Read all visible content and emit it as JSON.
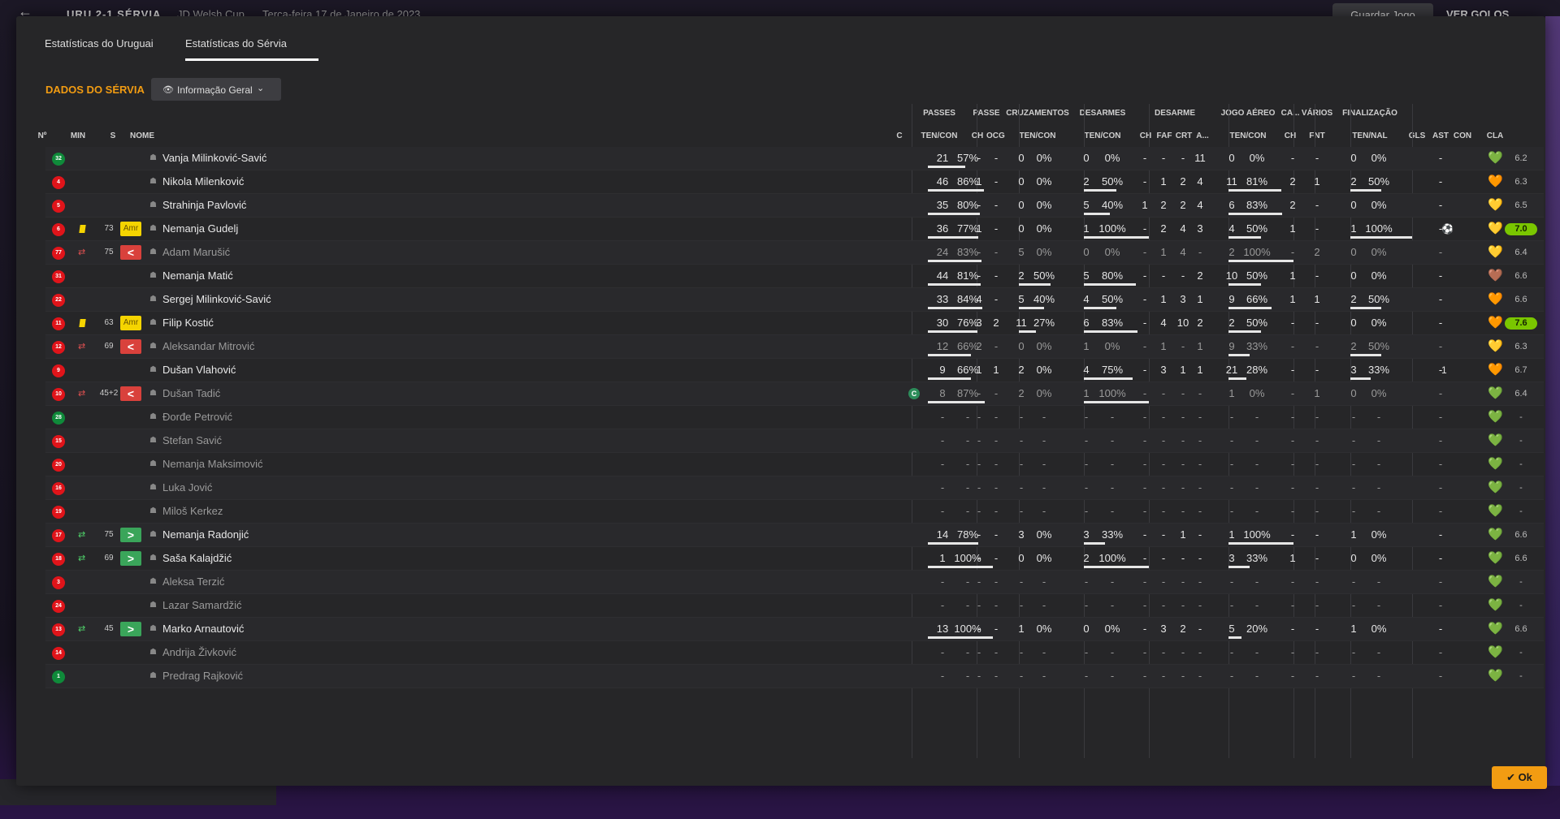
{
  "topbar": {
    "back": "←",
    "score": "URU 2-1 SÉRVIA",
    "competition": "JD Welsh Cup",
    "date": "Terça-feira 17 de Janeiro de 2023",
    "save": "Guardar Jogo",
    "see": "VER GOLOS"
  },
  "tabs": [
    "Estatísticas do Uruguai",
    "Estatísticas do Sérvia"
  ],
  "section_title": "DADOS DO SÉRVIA",
  "dropdown": {
    "label": "Informação Geral",
    "eye": "👁",
    "chevron": "⌄"
  },
  "groups": [
    "PASSES",
    "PASSE",
    "CRUZAMENTOS",
    "DESARMES",
    "DESARME",
    "JOGO AÉREO",
    "CA...",
    "VÁRIOS",
    "FINALIZAÇÃO"
  ],
  "headers": {
    "num": "Nº",
    "min": "MIN",
    "s": "S",
    "name": "NOME",
    "c": "C",
    "passes": "TEN/CON",
    "passe_ch": "CH",
    "passe_ocg": "OCG",
    "cruz": "TEN/CON",
    "desarmes": "TEN/CON",
    "des_ch": "CH",
    "des_faf": "FAF",
    "des_crt": "CRT",
    "des_a": "A...",
    "aereo": "TEN/CON",
    "ca_ch": "CH",
    "var_fnt": "FNT",
    "fin": "TEN/NAL",
    "gls": "GLS",
    "ast": "AST",
    "con": "CON",
    "cla": "CLA"
  },
  "ok_label": "✔ Ok",
  "colors": {
    "accent": "#f29c12",
    "red_shirt": "#e0141a",
    "green_shirt": "#0f8a3a",
    "sub_in": "#3aa55a",
    "sub_out": "#d9413c",
    "rating_hi": "#7ac600"
  },
  "players": [
    {
      "num": "32",
      "shirt": "green",
      "card": false,
      "sub": "",
      "min": "",
      "s": "",
      "name": "Vanja Milinković-Savić",
      "cap": false,
      "dim": false,
      "p_ten": "21",
      "p_pct": "57%",
      "p_fill": 0.57,
      "ch": "-",
      "ocg": "-",
      "cr_ten": "0",
      "cr_pct": "0%",
      "cr_fill": 0,
      "d_ten": "0",
      "d_pct": "0%",
      "d_fill": 0,
      "dch": "-",
      "faf": "-",
      "crt": "-",
      "a": "11",
      "ae_ten": "0",
      "ae_pct": "0%",
      "ae_fill": 0,
      "ca": "-",
      "fnt": "-",
      "f_ten": "0",
      "f_pct": "0%",
      "f_fill": 0,
      "gls": "",
      "ast": "-",
      "con": "💚",
      "cla": "6.2",
      "hi": false
    },
    {
      "num": "4",
      "shirt": "red",
      "card": false,
      "sub": "",
      "min": "",
      "s": "",
      "name": "Nikola Milenković",
      "cap": false,
      "dim": false,
      "p_ten": "46",
      "p_pct": "86%",
      "p_fill": 0.86,
      "ch": "1",
      "ocg": "-",
      "cr_ten": "0",
      "cr_pct": "0%",
      "cr_fill": 0,
      "d_ten": "2",
      "d_pct": "50%",
      "d_fill": 0.5,
      "dch": "-",
      "faf": "1",
      "crt": "2",
      "a": "4",
      "ae_ten": "11",
      "ae_pct": "81%",
      "ae_fill": 0.81,
      "ca": "2",
      "fnt": "1",
      "f_ten": "2",
      "f_pct": "50%",
      "f_fill": 0.5,
      "gls": "",
      "ast": "-",
      "con": "🧡",
      "cla": "6.3",
      "hi": false
    },
    {
      "num": "5",
      "shirt": "red",
      "card": false,
      "sub": "",
      "min": "",
      "s": "",
      "name": "Strahinja Pavlović",
      "cap": false,
      "dim": false,
      "p_ten": "35",
      "p_pct": "80%",
      "p_fill": 0.8,
      "ch": "-",
      "ocg": "-",
      "cr_ten": "0",
      "cr_pct": "0%",
      "cr_fill": 0,
      "d_ten": "5",
      "d_pct": "40%",
      "d_fill": 0.4,
      "dch": "1",
      "faf": "2",
      "crt": "2",
      "a": "4",
      "ae_ten": "6",
      "ae_pct": "83%",
      "ae_fill": 0.83,
      "ca": "2",
      "fnt": "-",
      "f_ten": "0",
      "f_pct": "0%",
      "f_fill": 0,
      "gls": "",
      "ast": "-",
      "con": "💛",
      "cla": "6.5",
      "hi": false
    },
    {
      "num": "6",
      "shirt": "red",
      "card": true,
      "sub": "",
      "min": "73",
      "s": "Amr",
      "name": "Nemanja Gudelj",
      "cap": false,
      "dim": false,
      "p_ten": "36",
      "p_pct": "77%",
      "p_fill": 0.77,
      "ch": "1",
      "ocg": "-",
      "cr_ten": "0",
      "cr_pct": "0%",
      "cr_fill": 0,
      "d_ten": "1",
      "d_pct": "100%",
      "d_fill": 1,
      "dch": "-",
      "faf": "2",
      "crt": "4",
      "a": "3",
      "ae_ten": "4",
      "ae_pct": "50%",
      "ae_fill": 0.5,
      "ca": "1",
      "fnt": "-",
      "f_ten": "1",
      "f_pct": "100%",
      "f_fill": 1,
      "gls": "⚽",
      "ast": "-",
      "con": "💛",
      "cla": "7.0",
      "hi": true
    },
    {
      "num": "77",
      "shirt": "red",
      "card": false,
      "sub": "out",
      "min": "75",
      "s": "<",
      "name": "Adam Marušić",
      "cap": false,
      "dim": true,
      "p_ten": "24",
      "p_pct": "83%",
      "p_fill": 0.83,
      "ch": "-",
      "ocg": "-",
      "cr_ten": "5",
      "cr_pct": "0%",
      "cr_fill": 0,
      "d_ten": "0",
      "d_pct": "0%",
      "d_fill": 0,
      "dch": "-",
      "faf": "1",
      "crt": "4",
      "a": "-",
      "ae_ten": "2",
      "ae_pct": "100%",
      "ae_fill": 1,
      "ca": "-",
      "fnt": "2",
      "f_ten": "0",
      "f_pct": "0%",
      "f_fill": 0,
      "gls": "",
      "ast": "-",
      "con": "💛",
      "cla": "6.4",
      "hi": false
    },
    {
      "num": "31",
      "shirt": "red",
      "card": false,
      "sub": "",
      "min": "",
      "s": "",
      "name": "Nemanja Matić",
      "cap": false,
      "dim": false,
      "p_ten": "44",
      "p_pct": "81%",
      "p_fill": 0.81,
      "ch": "-",
      "ocg": "-",
      "cr_ten": "2",
      "cr_pct": "50%",
      "cr_fill": 0.5,
      "d_ten": "5",
      "d_pct": "80%",
      "d_fill": 0.8,
      "dch": "-",
      "faf": "-",
      "crt": "-",
      "a": "2",
      "ae_ten": "10",
      "ae_pct": "50%",
      "ae_fill": 0.5,
      "ca": "1",
      "fnt": "-",
      "f_ten": "0",
      "f_pct": "0%",
      "f_fill": 0,
      "gls": "",
      "ast": "-",
      "con": "🤎",
      "cla": "6.6",
      "hi": false
    },
    {
      "num": "22",
      "shirt": "red",
      "card": false,
      "sub": "",
      "min": "",
      "s": "",
      "name": "Sergej Milinković-Savić",
      "cap": false,
      "dim": false,
      "p_ten": "33",
      "p_pct": "84%",
      "p_fill": 0.84,
      "ch": "4",
      "ocg": "-",
      "cr_ten": "5",
      "cr_pct": "40%",
      "cr_fill": 0.4,
      "d_ten": "4",
      "d_pct": "50%",
      "d_fill": 0.5,
      "dch": "-",
      "faf": "1",
      "crt": "3",
      "a": "1",
      "ae_ten": "9",
      "ae_pct": "66%",
      "ae_fill": 0.66,
      "ca": "1",
      "fnt": "1",
      "f_ten": "2",
      "f_pct": "50%",
      "f_fill": 0.5,
      "gls": "",
      "ast": "-",
      "con": "🧡",
      "cla": "6.6",
      "hi": false
    },
    {
      "num": "11",
      "shirt": "red",
      "card": true,
      "sub": "",
      "min": "63",
      "s": "Amr",
      "name": "Filip Kostić",
      "cap": false,
      "dim": false,
      "p_ten": "30",
      "p_pct": "76%",
      "p_fill": 0.76,
      "ch": "3",
      "ocg": "2",
      "cr_ten": "11",
      "cr_pct": "27%",
      "cr_fill": 0.27,
      "d_ten": "6",
      "d_pct": "83%",
      "d_fill": 0.83,
      "dch": "-",
      "faf": "4",
      "crt": "10",
      "a": "2",
      "ae_ten": "2",
      "ae_pct": "50%",
      "ae_fill": 0.5,
      "ca": "-",
      "fnt": "-",
      "f_ten": "0",
      "f_pct": "0%",
      "f_fill": 0,
      "gls": "",
      "ast": "-",
      "con": "🧡",
      "cla": "7.6",
      "hi": true
    },
    {
      "num": "12",
      "shirt": "red",
      "card": false,
      "sub": "out",
      "min": "69",
      "s": "<",
      "name": "Aleksandar Mitrović",
      "cap": false,
      "dim": true,
      "p_ten": "12",
      "p_pct": "66%",
      "p_fill": 0.66,
      "ch": "2",
      "ocg": "-",
      "cr_ten": "0",
      "cr_pct": "0%",
      "cr_fill": 0,
      "d_ten": "1",
      "d_pct": "0%",
      "d_fill": 0,
      "dch": "-",
      "faf": "1",
      "crt": "-",
      "a": "1",
      "ae_ten": "9",
      "ae_pct": "33%",
      "ae_fill": 0.33,
      "ca": "-",
      "fnt": "-",
      "f_ten": "2",
      "f_pct": "50%",
      "f_fill": 0.5,
      "gls": "",
      "ast": "-",
      "con": "💛",
      "cla": "6.3",
      "hi": false
    },
    {
      "num": "9",
      "shirt": "red",
      "card": false,
      "sub": "",
      "min": "",
      "s": "",
      "name": "Dušan Vlahović",
      "cap": false,
      "dim": false,
      "p_ten": "9",
      "p_pct": "66%",
      "p_fill": 0.66,
      "ch": "1",
      "ocg": "1",
      "cr_ten": "2",
      "cr_pct": "0%",
      "cr_fill": 0,
      "d_ten": "4",
      "d_pct": "75%",
      "d_fill": 0.75,
      "dch": "-",
      "faf": "3",
      "crt": "1",
      "a": "1",
      "ae_ten": "21",
      "ae_pct": "28%",
      "ae_fill": 0.28,
      "ca": "-",
      "fnt": "-",
      "f_ten": "3",
      "f_pct": "33%",
      "f_fill": 0.33,
      "gls": "1",
      "ast": "-",
      "con": "🧡",
      "cla": "6.7",
      "hi": false
    },
    {
      "num": "10",
      "shirt": "red",
      "card": false,
      "sub": "out",
      "min": "45+2",
      "s": "<",
      "name": "Dušan Tadić",
      "cap": true,
      "dim": true,
      "p_ten": "8",
      "p_pct": "87%",
      "p_fill": 0.87,
      "ch": "-",
      "ocg": "-",
      "cr_ten": "2",
      "cr_pct": "0%",
      "cr_fill": 0,
      "d_ten": "1",
      "d_pct": "100%",
      "d_fill": 1,
      "dch": "-",
      "faf": "-",
      "crt": "-",
      "a": "-",
      "ae_ten": "1",
      "ae_pct": "0%",
      "ae_fill": 0,
      "ca": "-",
      "fnt": "1",
      "f_ten": "0",
      "f_pct": "0%",
      "f_fill": 0,
      "gls": "",
      "ast": "-",
      "con": "💚",
      "cla": "6.4",
      "hi": false
    },
    {
      "num": "28",
      "shirt": "green",
      "card": false,
      "sub": "",
      "min": "",
      "s": "",
      "name": "Đorđe Petrović",
      "cap": false,
      "dim": true,
      "empty": true,
      "con": "💚",
      "cla": "-",
      "hi": false
    },
    {
      "num": "15",
      "shirt": "red",
      "card": false,
      "sub": "",
      "min": "",
      "s": "",
      "name": "Stefan Savić",
      "cap": false,
      "dim": true,
      "empty": true,
      "con": "💚",
      "cla": "-",
      "hi": false
    },
    {
      "num": "20",
      "shirt": "red",
      "card": false,
      "sub": "",
      "min": "",
      "s": "",
      "name": "Nemanja Maksimović",
      "cap": false,
      "dim": true,
      "empty": true,
      "con": "💚",
      "cla": "-",
      "hi": false
    },
    {
      "num": "16",
      "shirt": "red",
      "card": false,
      "sub": "",
      "min": "",
      "s": "",
      "name": "Luka Jović",
      "cap": false,
      "dim": true,
      "empty": true,
      "con": "💚",
      "cla": "-",
      "hi": false
    },
    {
      "num": "19",
      "shirt": "red",
      "card": false,
      "sub": "",
      "min": "",
      "s": "",
      "name": "Miloš Kerkez",
      "cap": false,
      "dim": true,
      "empty": true,
      "con": "💚",
      "cla": "-",
      "hi": false
    },
    {
      "num": "17",
      "shirt": "red",
      "card": false,
      "sub": "in",
      "min": "75",
      "s": ">",
      "name": "Nemanja Radonjić",
      "cap": false,
      "dim": false,
      "p_ten": "14",
      "p_pct": "78%",
      "p_fill": 0.78,
      "ch": "-",
      "ocg": "-",
      "cr_ten": "3",
      "cr_pct": "0%",
      "cr_fill": 0,
      "d_ten": "3",
      "d_pct": "33%",
      "d_fill": 0.33,
      "dch": "-",
      "faf": "-",
      "crt": "1",
      "a": "-",
      "ae_ten": "1",
      "ae_pct": "100%",
      "ae_fill": 1,
      "ca": "-",
      "fnt": "-",
      "f_ten": "1",
      "f_pct": "0%",
      "f_fill": 0,
      "gls": "",
      "ast": "-",
      "con": "💚",
      "cla": "6.6",
      "hi": false
    },
    {
      "num": "18",
      "shirt": "red",
      "card": false,
      "sub": "in",
      "min": "69",
      "s": ">",
      "name": "Saša Kalajdžić",
      "cap": false,
      "dim": false,
      "p_ten": "1",
      "p_pct": "100%",
      "p_fill": 1,
      "ch": "-",
      "ocg": "-",
      "cr_ten": "0",
      "cr_pct": "0%",
      "cr_fill": 0,
      "d_ten": "2",
      "d_pct": "100%",
      "d_fill": 1,
      "dch": "-",
      "faf": "-",
      "crt": "-",
      "a": "-",
      "ae_ten": "3",
      "ae_pct": "33%",
      "ae_fill": 0.33,
      "ca": "1",
      "fnt": "-",
      "f_ten": "0",
      "f_pct": "0%",
      "f_fill": 0,
      "gls": "",
      "ast": "-",
      "con": "💚",
      "cla": "6.6",
      "hi": false
    },
    {
      "num": "3",
      "shirt": "red",
      "card": false,
      "sub": "",
      "min": "",
      "s": "",
      "name": "Aleksa Terzić",
      "cap": false,
      "dim": true,
      "empty": true,
      "con": "💚",
      "cla": "-",
      "hi": false
    },
    {
      "num": "24",
      "shirt": "red",
      "card": false,
      "sub": "",
      "min": "",
      "s": "",
      "name": "Lazar Samardžić",
      "cap": false,
      "dim": true,
      "empty": true,
      "con": "💚",
      "cla": "-",
      "hi": false
    },
    {
      "num": "13",
      "shirt": "red",
      "card": false,
      "sub": "in",
      "min": "45",
      "s": ">",
      "name": "Marko Arnautović",
      "cap": false,
      "dim": false,
      "p_ten": "13",
      "p_pct": "100%",
      "p_fill": 1,
      "ch": "-",
      "ocg": "-",
      "cr_ten": "1",
      "cr_pct": "0%",
      "cr_fill": 0,
      "d_ten": "0",
      "d_pct": "0%",
      "d_fill": 0,
      "dch": "-",
      "faf": "3",
      "crt": "2",
      "a": "-",
      "ae_ten": "5",
      "ae_pct": "20%",
      "ae_fill": 0.2,
      "ca": "-",
      "fnt": "-",
      "f_ten": "1",
      "f_pct": "0%",
      "f_fill": 0,
      "gls": "",
      "ast": "-",
      "con": "💚",
      "cla": "6.6",
      "hi": false
    },
    {
      "num": "14",
      "shirt": "red",
      "card": false,
      "sub": "",
      "min": "",
      "s": "",
      "name": "Andrija Živković",
      "cap": false,
      "dim": true,
      "empty": true,
      "con": "💚",
      "cla": "-",
      "hi": false
    },
    {
      "num": "1",
      "shirt": "green",
      "card": false,
      "sub": "",
      "min": "",
      "s": "",
      "name": "Predrag Rajković",
      "cap": false,
      "dim": true,
      "empty": true,
      "con": "💚",
      "cla": "-",
      "hi": false
    }
  ]
}
